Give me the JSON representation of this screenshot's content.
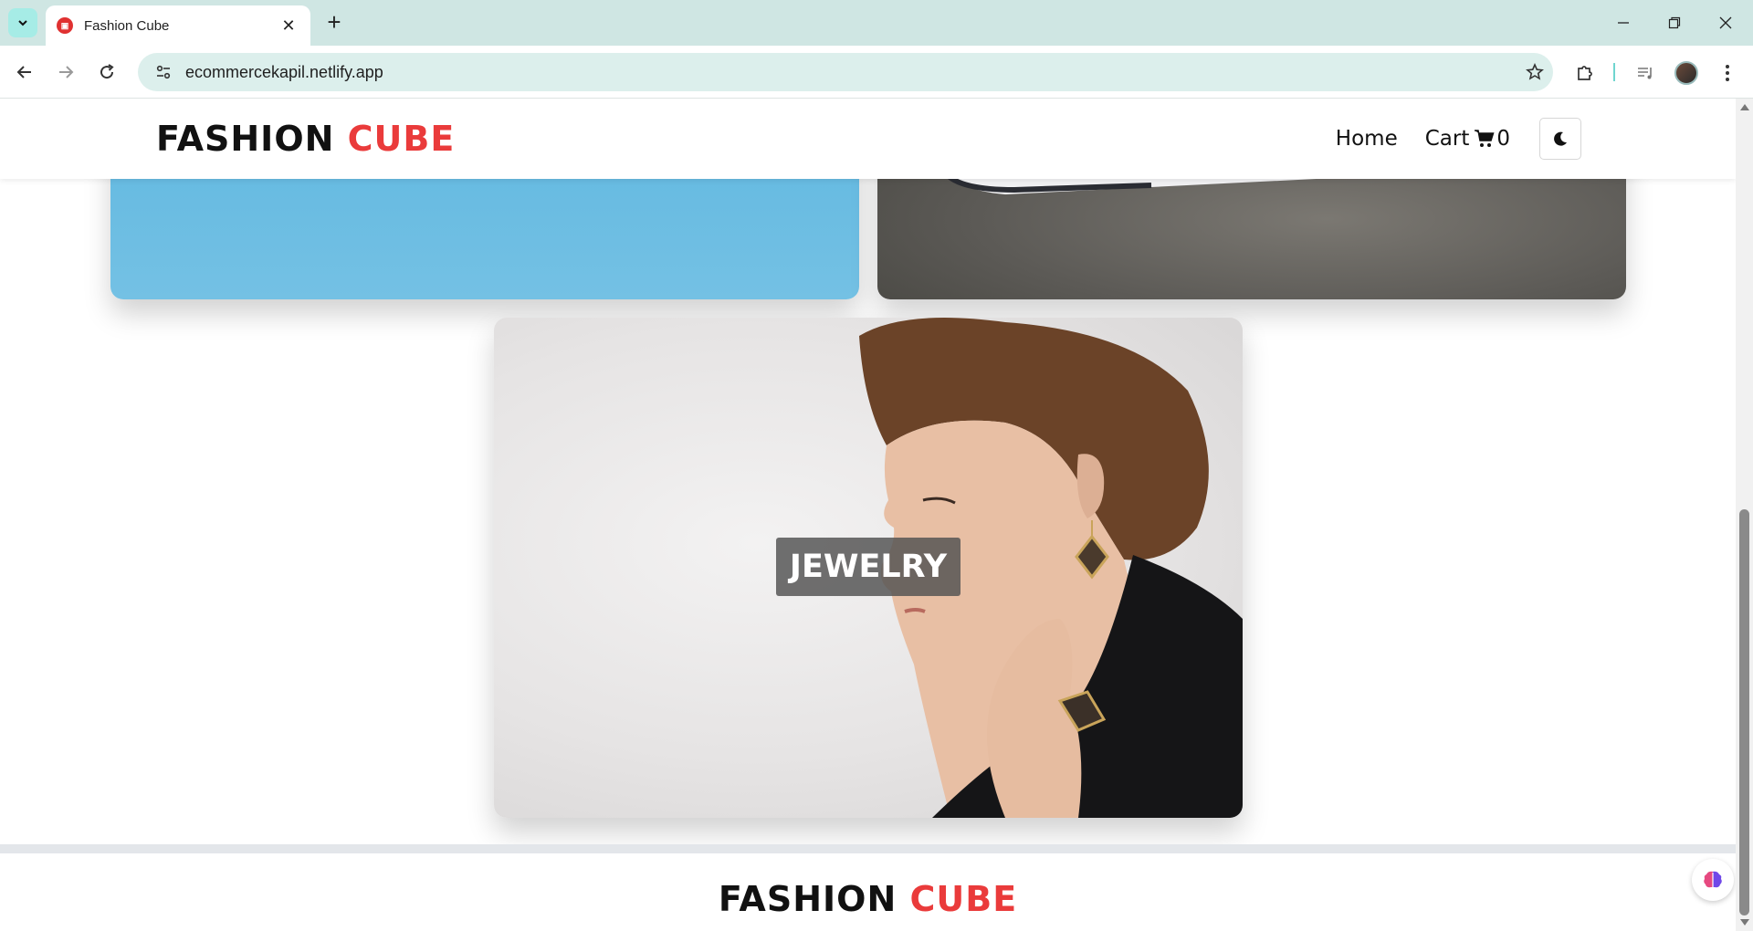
{
  "browser": {
    "tab_title": "Fashion Cube",
    "url": "ecommercekapil.netlify.app"
  },
  "header": {
    "logo_main": "FASHION",
    "logo_accent": "CUBE",
    "nav_home": "Home",
    "nav_cart": "Cart",
    "cart_count": "0",
    "icons": {
      "cart": "cart-icon",
      "theme": "moon-icon"
    }
  },
  "categories": [
    {
      "label": "JEWELRY"
    }
  ],
  "footer": {
    "logo_main": "FASHION",
    "logo_accent": "CUBE"
  },
  "colors": {
    "accent": "#ea3b3b",
    "browser_frame": "#cfe6e3",
    "omnibox": "#dcefec"
  }
}
